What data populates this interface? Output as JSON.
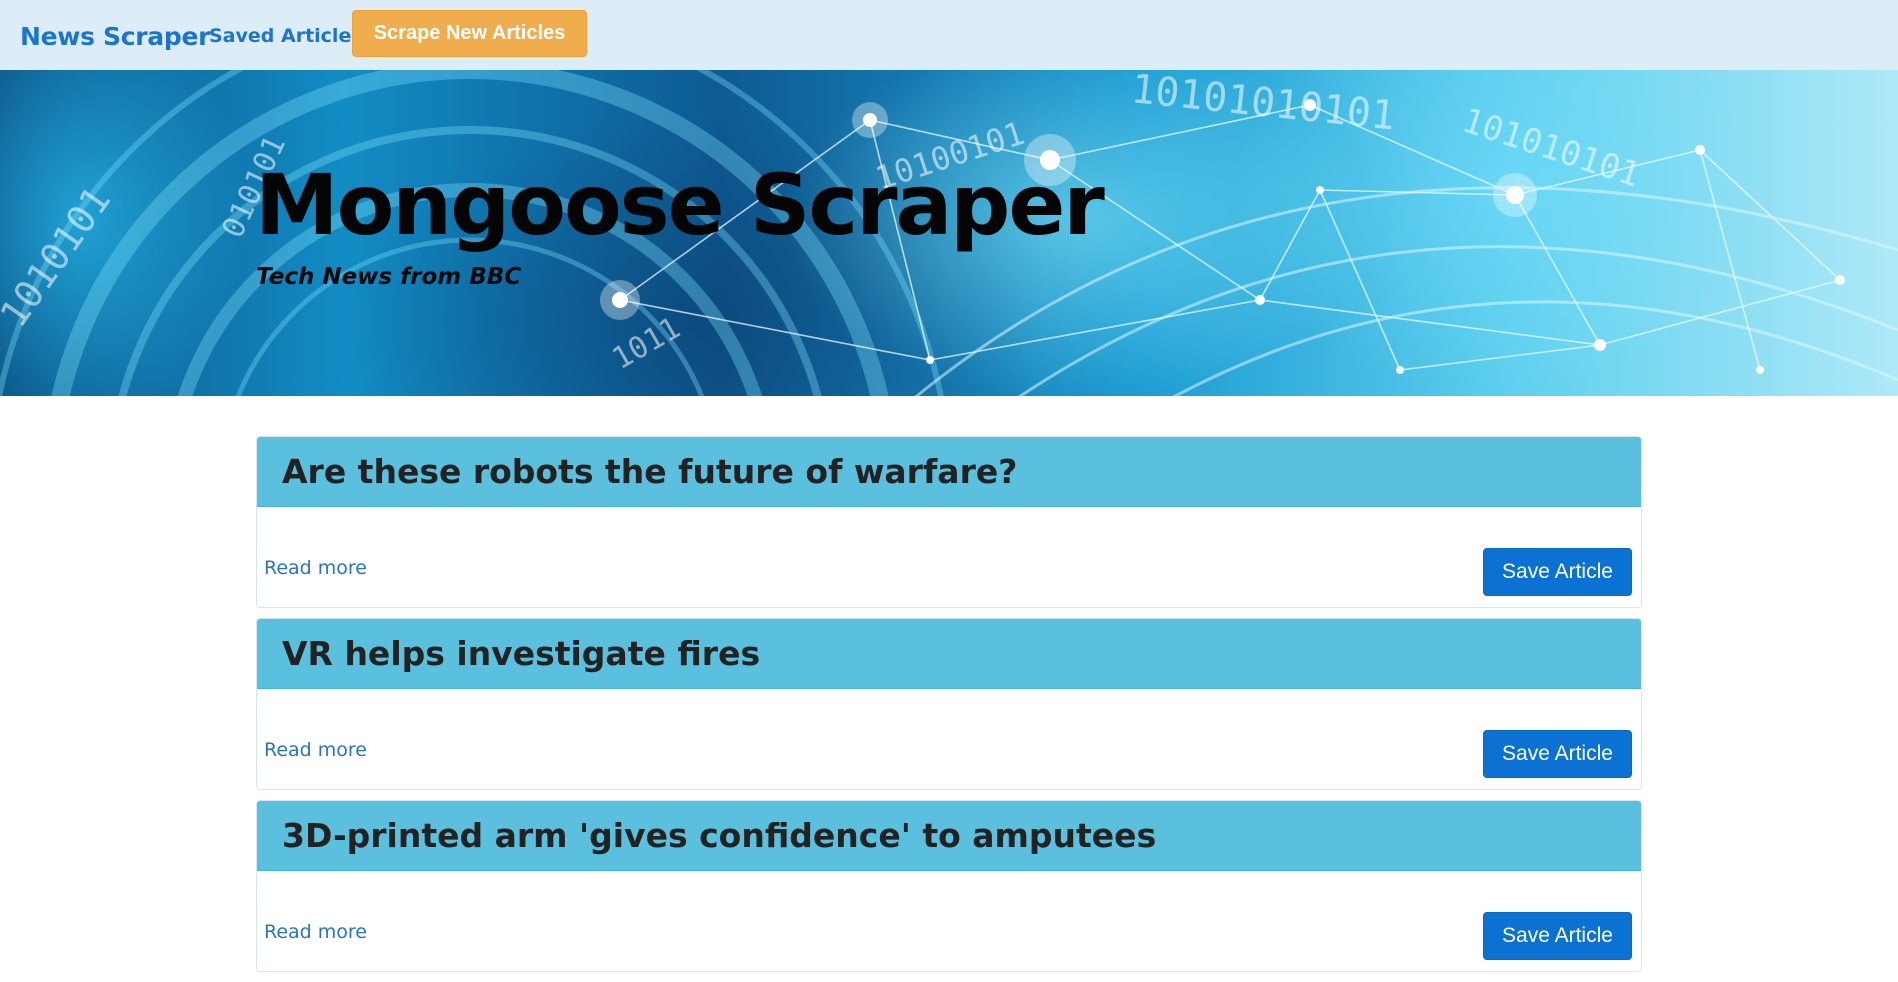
{
  "navbar": {
    "brand": "News Scraper",
    "saved_link": "Saved Articles",
    "scrape_button": "Scrape New Articles"
  },
  "hero": {
    "title": "Mongoose Scraper",
    "subtitle": "Tech News from BBC"
  },
  "articles": [
    {
      "title": "Are these robots the future of warfare?",
      "read_more": "Read more",
      "save_label": "Save Article"
    },
    {
      "title": "VR helps investigate fires",
      "read_more": "Read more",
      "save_label": "Save Article"
    },
    {
      "title": "3D-printed arm 'gives confidence' to amputees",
      "read_more": "Read more",
      "save_label": "Save Article"
    }
  ],
  "colors": {
    "navbar_bg": "#ddedf8",
    "brand": "#1b75cf",
    "scrape_button": "#f0ad4e",
    "card_heading": "#5bc0de",
    "save_button": "#0b72d3",
    "link": "#2a74c0"
  }
}
